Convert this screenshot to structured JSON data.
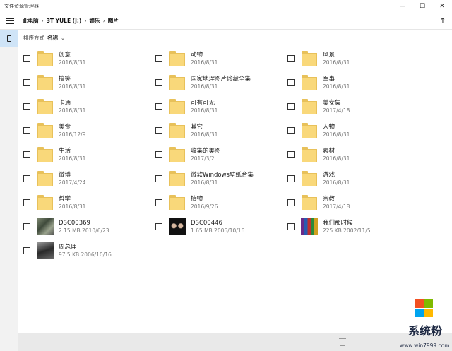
{
  "window": {
    "title": "文件资源管理器",
    "minimize_glyph": "—",
    "maximize_glyph": "☐",
    "close_glyph": "✕"
  },
  "address": {
    "crumbs": [
      "此电脑",
      "3T YULE (J:)",
      "娱乐",
      "图片"
    ],
    "separator": "›",
    "up_glyph": "↑"
  },
  "sort": {
    "label": "排序方式",
    "value": "名称",
    "chevron": "⌄"
  },
  "items": [
    {
      "name": "创意",
      "sub": "2016/8/31",
      "kind": "folder"
    },
    {
      "name": "动物",
      "sub": "2016/8/31",
      "kind": "folder"
    },
    {
      "name": "风景",
      "sub": "2016/8/31",
      "kind": "folder"
    },
    {
      "name": "搞笑",
      "sub": "2016/8/31",
      "kind": "folder"
    },
    {
      "name": "国家地理图片珍藏全集",
      "sub": "2016/8/31",
      "kind": "folder"
    },
    {
      "name": "军事",
      "sub": "2016/8/31",
      "kind": "folder"
    },
    {
      "name": "卡通",
      "sub": "2016/8/31",
      "kind": "folder"
    },
    {
      "name": "可有可无",
      "sub": "2016/8/31",
      "kind": "folder"
    },
    {
      "name": "美女集",
      "sub": "2017/4/18",
      "kind": "folder"
    },
    {
      "name": "美食",
      "sub": "2016/12/9",
      "kind": "folder"
    },
    {
      "name": "其它",
      "sub": "2016/8/31",
      "kind": "folder"
    },
    {
      "name": "人物",
      "sub": "2016/8/31",
      "kind": "folder"
    },
    {
      "name": "生活",
      "sub": "2016/8/31",
      "kind": "folder"
    },
    {
      "name": "收集的美图",
      "sub": "2017/3/2",
      "kind": "folder"
    },
    {
      "name": "素材",
      "sub": "2016/8/31",
      "kind": "folder"
    },
    {
      "name": "微博",
      "sub": "2017/4/24",
      "kind": "folder"
    },
    {
      "name": "微软Windows壁纸合集",
      "sub": "2016/8/31",
      "kind": "folder"
    },
    {
      "name": "游戏",
      "sub": "2016/8/31",
      "kind": "folder"
    },
    {
      "name": "哲学",
      "sub": "2016/8/31",
      "kind": "folder"
    },
    {
      "name": "植物",
      "sub": "2016/9/26",
      "kind": "folder"
    },
    {
      "name": "宗教",
      "sub": "2017/4/18",
      "kind": "folder"
    },
    {
      "name": "DSC00369",
      "sub": "2.15 MB 2010/6/23",
      "kind": "image",
      "thumb": "p1"
    },
    {
      "name": "DSC00446",
      "sub": "1.65 MB 2006/10/16",
      "kind": "image",
      "thumb": "p2"
    },
    {
      "name": "我们那时候",
      "sub": "225 KB 2002/11/5",
      "kind": "image",
      "thumb": "p3"
    },
    {
      "name": "周总理",
      "sub": "97.5 KB 2006/10/16",
      "kind": "image",
      "thumb": "p4"
    }
  ],
  "watermark": {
    "text": "系统粉",
    "url": "www.win7999.com",
    "colors": [
      "#f25022",
      "#7fba00",
      "#00a4ef",
      "#ffb900"
    ]
  }
}
